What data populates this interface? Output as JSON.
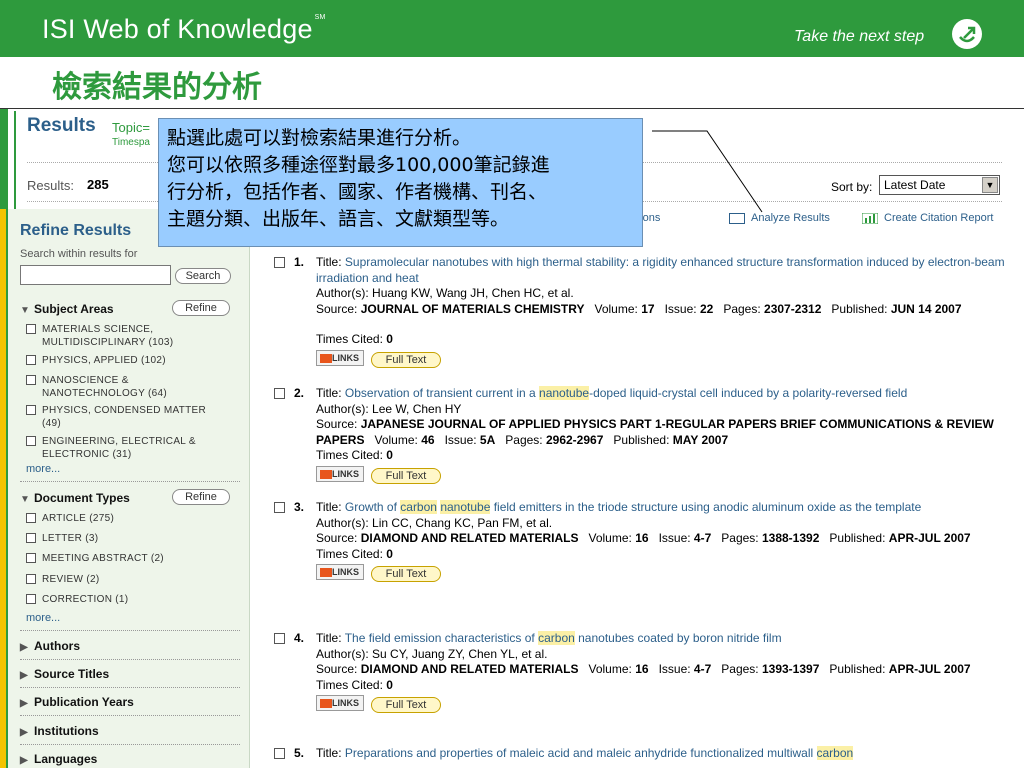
{
  "banner": {
    "brand": "ISI Web of Knowledge",
    "brand_tm": "SM",
    "tagline": "Take the next step",
    "bg_color": "#2e9a3d",
    "icon": "arrow-circle-icon"
  },
  "slide_title": "檢索結果的分析",
  "callout": {
    "line1": "點選此處可以對檢索結果進行分析。",
    "line2": "您可以依照多種途徑對最多100,000筆記錄進",
    "line3": "行分析，包括作者、國家、作者機構、刊名、",
    "line4": "主題分類、出版年、語言、文獻類型等。",
    "bg_color": "#99ccff"
  },
  "results": {
    "heading": "Results",
    "topic_prefix": "Topic=",
    "timespan_prefix": "Timespa",
    "count_label": "Results:",
    "count": "285",
    "sort_label": "Sort by:",
    "sort_value": "Latest Date",
    "options_fragment": "ptions",
    "analyze_label": "Analyze Results",
    "citation_label": "Create Citation Report"
  },
  "refine": {
    "title": "Refine Results",
    "search_within_label": "Search within results for",
    "search_button": "Search",
    "refine_button": "Refine",
    "subject_areas": {
      "title": "Subject Areas",
      "items": [
        {
          "l1": "MATERIALS SCIENCE,",
          "l2": "MULTIDISCIPLINARY (103)"
        },
        {
          "l1": "PHYSICS, APPLIED (102)",
          "l2": ""
        },
        {
          "l1": "NANOSCIENCE &",
          "l2": "NANOTECHNOLOGY (64)"
        },
        {
          "l1": "PHYSICS, CONDENSED MATTER",
          "l2": "(49)"
        },
        {
          "l1": "ENGINEERING, ELECTRICAL &",
          "l2": "ELECTRONIC (31)"
        }
      ],
      "more": "more..."
    },
    "document_types": {
      "title": "Document Types",
      "items": [
        "ARTICLE (275)",
        "LETTER (3)",
        "MEETING ABSTRACT (2)",
        "REVIEW (2)",
        "CORRECTION (1)"
      ],
      "more": "more..."
    },
    "collapsed_sections": [
      "Authors",
      "Source Titles",
      "Publication Years",
      "Institutions",
      "Languages"
    ]
  },
  "records": [
    {
      "num": "1.",
      "title_label": "Title:",
      "title": "Supramolecular nanotubes with high thermal stability: a rigidity enhanced structure transformation induced by electron-beam irradiation and heat",
      "authors_label": "Author(s):",
      "authors": "Huang KW, Wang JH, Chen HC, et al.",
      "source_label": "Source:",
      "source": "JOURNAL OF MATERIALS CHEMISTRY",
      "volume_label": "Volume:",
      "volume": "17",
      "issue_label": "Issue:",
      "issue": "22",
      "pages_label": "Pages:",
      "pages": "2307-2312",
      "published_label": "Published:",
      "published": "JUN 14 2007",
      "cited_label": "Times Cited:",
      "cited": "0"
    },
    {
      "num": "2.",
      "title_label": "Title:",
      "title_pre": "Observation of transient current in a ",
      "title_hl": "nanotube",
      "title_post": "-doped liquid-crystal cell induced by a polarity-reversed field",
      "authors_label": "Author(s):",
      "authors": "Lee W, Chen HY",
      "source_label": "Source:",
      "source": "JAPANESE JOURNAL OF APPLIED PHYSICS PART 1-REGULAR PAPERS BRIEF COMMUNICATIONS & REVIEW PAPERS",
      "volume_label": "Volume:",
      "volume": "46",
      "issue_label": "Issue:",
      "issue": "5A",
      "pages_label": "Pages:",
      "pages": "2962-2967",
      "published_label": "Published:",
      "published": "MAY 2007",
      "cited_label": "Times Cited:",
      "cited": "0"
    },
    {
      "num": "3.",
      "title_label": "Title:",
      "title_pre": "Growth of ",
      "title_hl": "carbon",
      "title_mid": " ",
      "title_hl2": "nanotube",
      "title_post": " field emitters in the triode structure using anodic aluminum oxide as the template",
      "authors_label": "Author(s):",
      "authors": "Lin CC, Chang KC, Pan FM, et al.",
      "source_label": "Source:",
      "source": "DIAMOND AND RELATED MATERIALS",
      "volume_label": "Volume:",
      "volume": "16",
      "issue_label": "Issue:",
      "issue": "4-7",
      "pages_label": "Pages:",
      "pages": "1388-1392",
      "published_label": "Published:",
      "published": "APR-JUL 2007",
      "cited_label": "Times Cited:",
      "cited": "0"
    },
    {
      "num": "4.",
      "title_label": "Title:",
      "title_pre": "The field emission characteristics of ",
      "title_hl": "carbon",
      "title_post": " nanotubes coated by boron nitride film",
      "authors_label": "Author(s):",
      "authors": "Su CY, Juang ZY, Chen YL, et al.",
      "source_label": "Source:",
      "source": "DIAMOND AND RELATED MATERIALS",
      "volume_label": "Volume:",
      "volume": "16",
      "issue_label": "Issue:",
      "issue": "4-7",
      "pages_label": "Pages:",
      "pages": "1393-1397",
      "published_label": "Published:",
      "published": "APR-JUL 2007",
      "cited_label": "Times Cited:",
      "cited": "0"
    },
    {
      "num": "5.",
      "title_label": "Title:",
      "title_pre": "Preparations and properties of maleic acid and maleic anhydride functionalized multiwall ",
      "title_hl": "carbon"
    }
  ],
  "buttons": {
    "links": "LINKS",
    "full_text": "Full Text"
  }
}
